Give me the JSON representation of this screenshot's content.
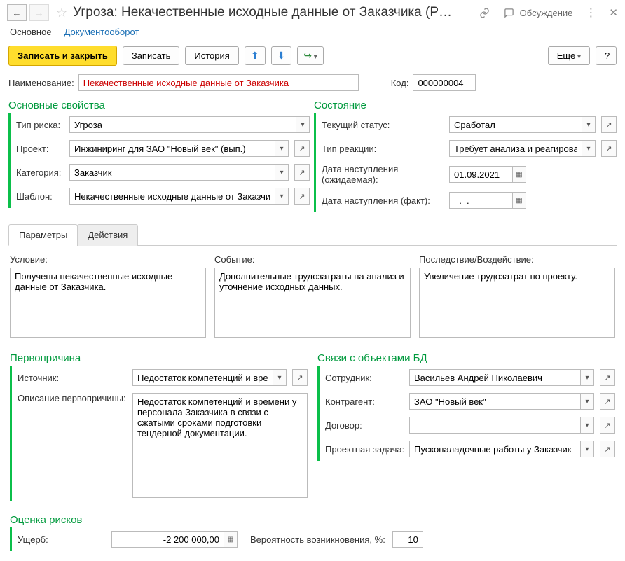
{
  "header": {
    "title": "Угроза: Некачественные исходные данные от Заказчика (Р…",
    "discuss_label": "Обсуждение"
  },
  "topTabs": {
    "main": "Основное",
    "docflow": "Документооборот"
  },
  "toolbar": {
    "save_close": "Записать и закрыть",
    "save": "Записать",
    "history": "История",
    "more": "Еще",
    "help": "?"
  },
  "nameRow": {
    "label": "Наименование:",
    "value": "Некачественные исходные данные от Заказчика",
    "code_label": "Код:",
    "code_value": "000000004"
  },
  "sections": {
    "main_props": "Основные свойства",
    "state": "Состояние",
    "root_cause": "Первопричина",
    "links": "Связи с объектами БД",
    "risk_eval": "Оценка рисков"
  },
  "mainProps": {
    "risk_type_label": "Тип риска:",
    "risk_type_value": "Угроза",
    "project_label": "Проект:",
    "project_value": "Инжиниринг для ЗАО \"Новый век\" (вып.)",
    "category_label": "Категория:",
    "category_value": "Заказчик",
    "template_label": "Шаблон:",
    "template_value": "Некачественные исходные данные от Заказчика"
  },
  "state": {
    "status_label": "Текущий статус:",
    "status_value": "Сработал",
    "reaction_label": "Тип реакции:",
    "reaction_value": "Требует анализа и реагирова",
    "date_exp_label": "Дата наступления (ожидаемая):",
    "date_exp_value": "01.09.2021",
    "date_fact_label": "Дата наступления (факт):",
    "date_fact_value": "  .  .    "
  },
  "innerTabs": {
    "params": "Параметры",
    "actions": "Действия"
  },
  "params": {
    "condition_label": "Условие:",
    "condition_value": "Получены некачественные исходные данные от Заказчика.",
    "event_label": "Событие:",
    "event_value": "Дополнительные трудозатраты на анализ и уточнение исходных данных.",
    "consequence_label": "Последствие/Воздействие:",
    "consequence_value": "Увеличение трудозатрат по проекту."
  },
  "rootCause": {
    "source_label": "Источник:",
    "source_value": "Недостаток компетенций и времени у п",
    "desc_label": "Описание первопричины:",
    "desc_value": "Недостаток компетенций и времени у персонала Заказчика в связи с сжатыми сроками подготовки тендерной документации."
  },
  "links": {
    "employee_label": "Сотрудник:",
    "employee_value": "Васильев Андрей Николаевич",
    "counterparty_label": "Контрагент:",
    "counterparty_value": "ЗАО \"Новый век\"",
    "contract_label": "Договор:",
    "contract_value": "",
    "task_label": "Проектная задача:",
    "task_value": "Пусконаладочные работы у Заказчик"
  },
  "riskEval": {
    "damage_label": "Ущерб:",
    "damage_value": "-2 200 000,00",
    "prob_label": "Вероятность возникновения, %:",
    "prob_value": "10"
  }
}
